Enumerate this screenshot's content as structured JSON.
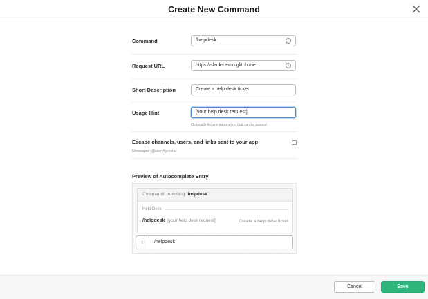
{
  "dialog": {
    "title": "Create New Command"
  },
  "form": {
    "command": {
      "label": "Command",
      "value": "/helpdesk"
    },
    "request_url": {
      "label": "Request URL",
      "value": "https://slack-demo.glitch.me"
    },
    "short_description": {
      "label": "Short Description",
      "value": "Create a help desk ticket"
    },
    "usage_hint": {
      "label": "Usage Hint",
      "value": "[your help desk request]",
      "help": "Optionally list any parameters that can be passed."
    },
    "escape": {
      "label": "Escape channels, users, and links sent to your app",
      "sub": "Unescaped: @user #general",
      "checked": false
    },
    "info_icon": "i"
  },
  "preview": {
    "title": "Preview of Autocomplete Entry",
    "matching_prefix": "Commands matching \"",
    "matching_term": "helpdesk",
    "matching_suffix": "\"",
    "group": "Help Desk",
    "command": "/helpdesk",
    "hint": "[your help desk request]",
    "description": "Create a help desk ticket",
    "input_plus": "+",
    "input_text": "/helpdesk"
  },
  "footer": {
    "cancel": "Cancel",
    "save": "Save"
  },
  "colors": {
    "save": "#2eb67d",
    "focus": "#4a8fd6"
  }
}
